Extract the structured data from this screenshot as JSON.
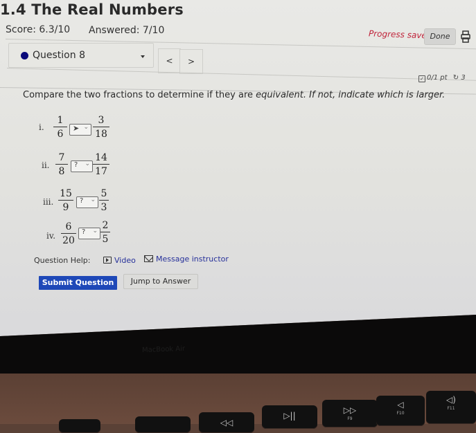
{
  "header": {
    "title": "1.4 The Real Numbers",
    "score": "Score: 6.3/10",
    "answered": "Answered: 7/10",
    "progress_status": "Progress saved",
    "done_label": "Done",
    "print_icon": "printer-icon"
  },
  "question_nav": {
    "selected_question": "Question 8",
    "prev_label": "<",
    "next_label": ">",
    "points": "0/1 pt",
    "retry_count": "3"
  },
  "question": {
    "prompt_plain": "Compare the two fractions to determine if they are ",
    "prompt_italic": "equivalent.  If not, indicate which is larger.",
    "items": [
      {
        "roman": "i.",
        "left": {
          "num": "1",
          "den": "6"
        },
        "selection": "",
        "right": {
          "num": "3",
          "den": "18"
        }
      },
      {
        "roman": "ii.",
        "left": {
          "num": "7",
          "den": "8"
        },
        "selection": "?",
        "right": {
          "num": "14",
          "den": "17"
        }
      },
      {
        "roman": "iii.",
        "left": {
          "num": "15",
          "den": "9"
        },
        "selection": "?",
        "right": {
          "num": "5",
          "den": "3"
        }
      },
      {
        "roman": "iv.",
        "left": {
          "num": "6",
          "den": "20"
        },
        "selection": "?",
        "right": {
          "num": "2",
          "den": "5"
        }
      }
    ]
  },
  "help": {
    "label": "Question Help:",
    "video": "Video",
    "message": "Message instructor"
  },
  "actions": {
    "submit": "Submit Question",
    "jump": "Jump to Answer"
  },
  "device": {
    "bezel_label": "MacBook Air",
    "keys": [
      {
        "glyph": "◁◁",
        "sub": ""
      },
      {
        "glyph": "▷||",
        "sub": ""
      },
      {
        "glyph": "▷▷",
        "sub": "F9"
      },
      {
        "glyph": "◁",
        "sub": "F10"
      },
      {
        "glyph": "◁)",
        "sub": "F11"
      }
    ]
  },
  "colors": {
    "accent": "#1e48b8",
    "link": "#26309a",
    "progress": "#c0243a"
  }
}
